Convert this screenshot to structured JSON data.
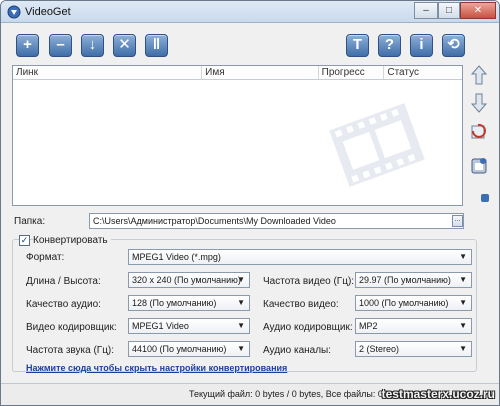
{
  "window": {
    "title": "VideoGet",
    "controls": {
      "minimize": "–",
      "maximize": "□",
      "close": "✕"
    }
  },
  "toolbar": {
    "left": [
      {
        "name": "add",
        "glyph": "+"
      },
      {
        "name": "remove",
        "glyph": "–"
      },
      {
        "name": "download",
        "glyph": "↓"
      },
      {
        "name": "cancel",
        "glyph": "✕"
      },
      {
        "name": "pause",
        "glyph": "‖"
      }
    ],
    "right": [
      {
        "name": "options",
        "glyph": "T"
      },
      {
        "name": "help",
        "glyph": "?"
      },
      {
        "name": "info",
        "glyph": "i"
      },
      {
        "name": "exit",
        "glyph": "⟲"
      }
    ]
  },
  "list": {
    "columns": [
      "Линк",
      "Имя",
      "Прогресс",
      "Статус"
    ]
  },
  "side_buttons": [
    "move-up",
    "move-down",
    "refresh",
    "clear"
  ],
  "folder": {
    "label": "Папка:",
    "path": "C:\\Users\\Администратор\\Documents\\My Downloaded Video",
    "browse": "..."
  },
  "convert": {
    "checkbox_label": "Конвертировать",
    "checked": true,
    "format_label": "Формат:",
    "format_value": "MPEG1 Video (*.mpg)",
    "size_label": "Длина / Высота:",
    "size_value": "320 x 240 (По умолчанию)",
    "fps_label": "Частота видео (Гц):",
    "fps_value": "29.97 (По умолчанию)",
    "audio_quality_label": "Качество аудио:",
    "audio_quality_value": "128 (По умолчанию)",
    "video_quality_label": "Качество видео:",
    "video_quality_value": "1000 (По умолчанию)",
    "video_codec_label": "Видео кодировщик:",
    "video_codec_value": "MPEG1 Video",
    "audio_codec_label": "Аудио кодировщик:",
    "audio_codec_value": "MP2",
    "sample_rate_label": "Частота звука (Гц):",
    "sample_rate_value": "44100 (По умолчанию)",
    "channels_label": "Аудио каналы:",
    "channels_value": "2 (Stereo)",
    "hide_link": "Нажмите сюда чтобы скрыть настройки конвертирования"
  },
  "status_bar": {
    "text": "Текущий файл: 0 bytes / 0 bytes,  Все файлы: 0 bytes"
  },
  "watermark": "testmasterx.ucoz.ru"
}
